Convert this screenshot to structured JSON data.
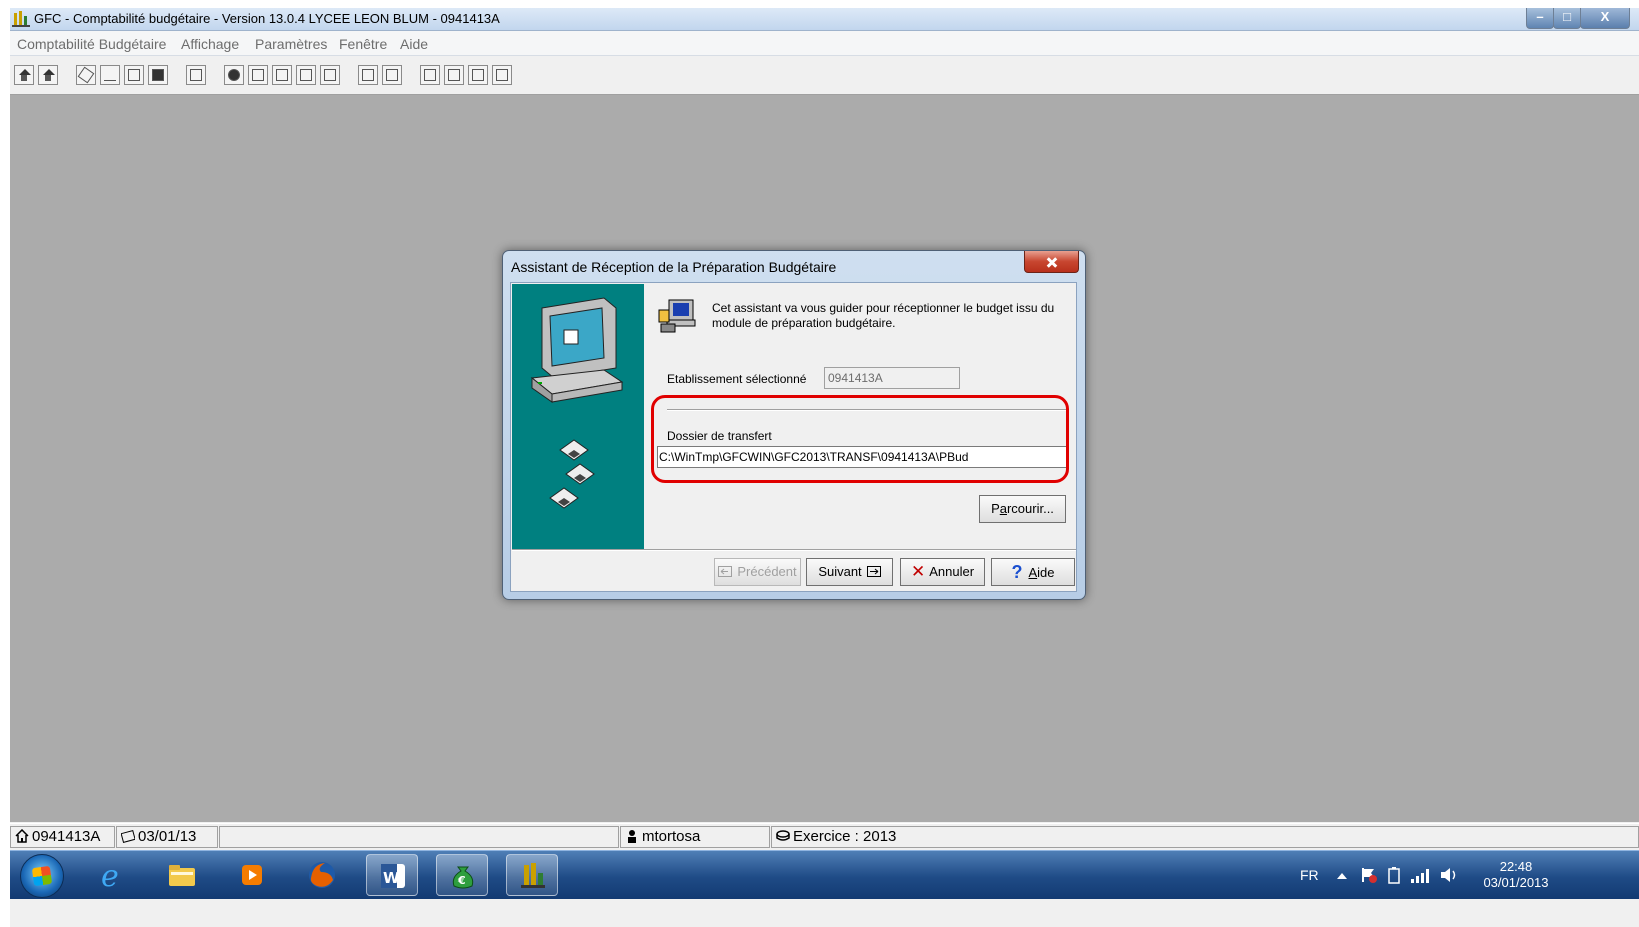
{
  "window": {
    "title": "GFC - Comptabilité budgétaire - Version 13.0.4   LYCEE LEON BLUM - 0941413A",
    "minimize": "–",
    "maximize": "□",
    "close": "X"
  },
  "menu": [
    "Comptabilité Budgétaire",
    "Affichage",
    "Paramètres",
    "Fenêtre",
    "Aide"
  ],
  "toolbar": {
    "icons": [
      "home-icon",
      "home-edit-icon",
      "eraser-icon",
      "blank-icon",
      "page-icon",
      "book-icon",
      "card-icon",
      "user-pen-icon",
      "truck-icon",
      "form-icon",
      "form-icon",
      "form-icon",
      "doc-icon",
      "doc-icon",
      "grid-icon",
      "grid-icon",
      "grid-icon",
      "grid-icon"
    ]
  },
  "dialog": {
    "title": "Assistant de Réception de la Préparation Budgétaire",
    "intro": "Cet assistant va vous guider pour réceptionner le budget issu du module de préparation budgétaire.",
    "etab_label": "Etablissement sélectionné",
    "etab_value": "0941413A",
    "dossier_label": "Dossier de transfert",
    "dossier_value": "C:\\WinTmp\\GFCWIN\\GFC2013\\TRANSF\\0941413A\\PBud",
    "browse_pre": "P",
    "browse_u": "a",
    "browse_post": "rcourir...",
    "prev": "Précédent",
    "next": "Suivant",
    "cancel": "Annuler",
    "help_u": "A",
    "help_post": "ide"
  },
  "status": {
    "etab": "0941413A",
    "date": "03/01/13",
    "user": "mtortosa",
    "exercice": "Exercice : 2013"
  },
  "taskbar": {
    "lang": "FR",
    "time": "22:48",
    "date": "03/01/2013"
  },
  "colors": {
    "wizard_panel": "#008080",
    "highlight": "#e00000"
  }
}
